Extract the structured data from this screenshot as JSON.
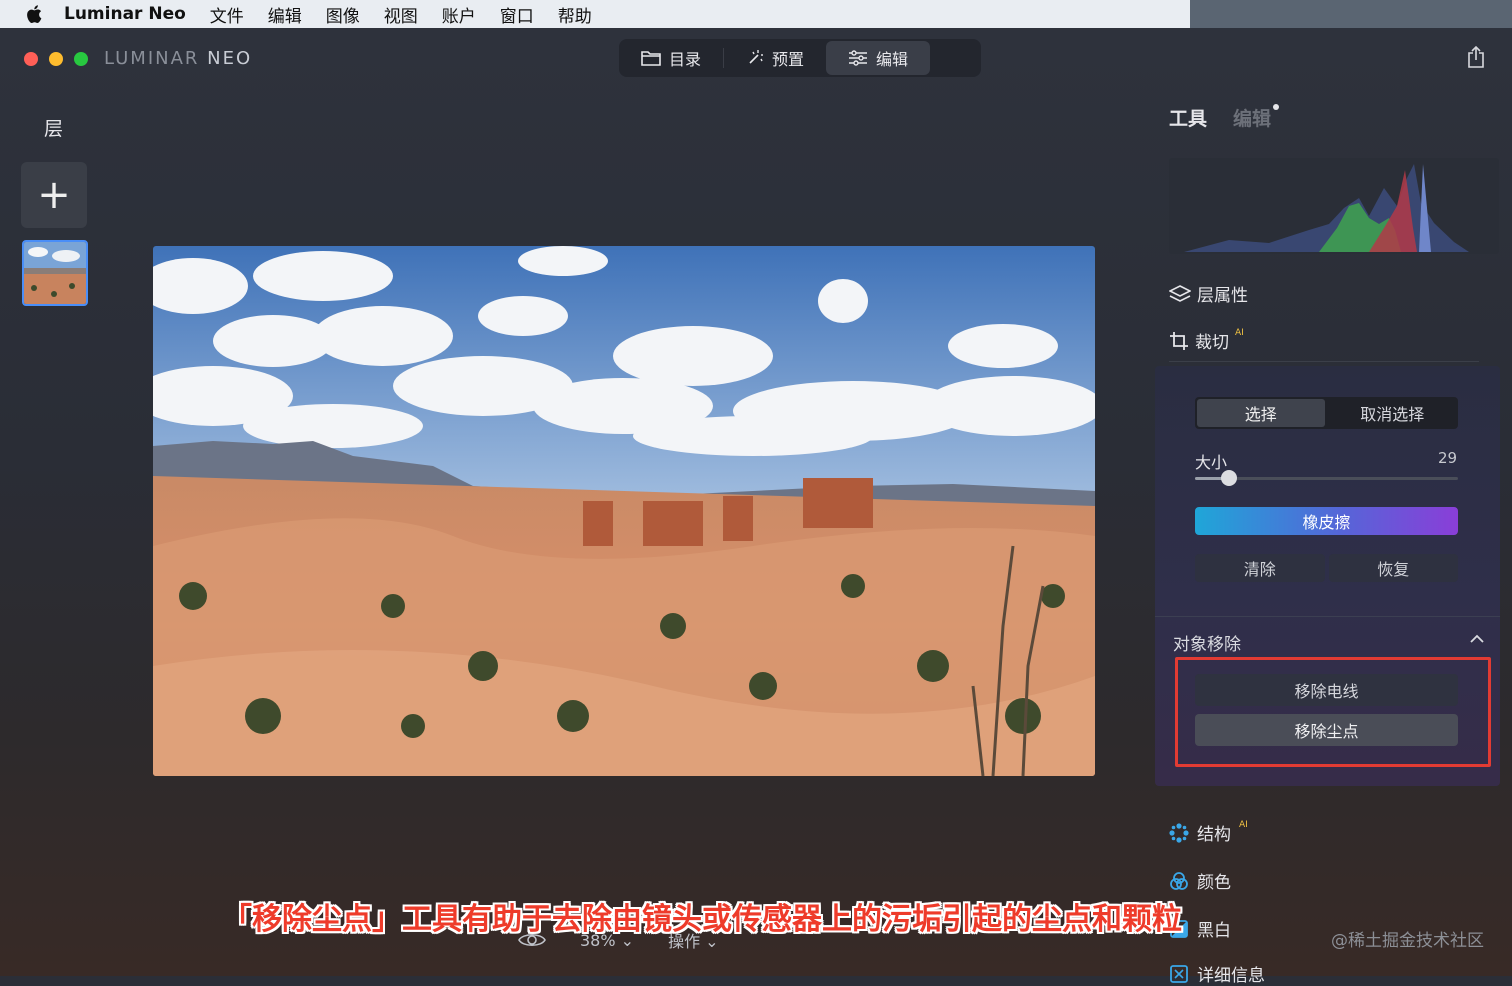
{
  "menubar": {
    "app_name": "Luminar Neo",
    "items": [
      "文件",
      "编辑",
      "图像",
      "视图",
      "账户",
      "窗口",
      "帮助"
    ]
  },
  "header": {
    "logo_a": "LUMINAR",
    "logo_b": "NEO",
    "tabs": [
      {
        "label": "目录",
        "icon": "folder-icon"
      },
      {
        "label": "预置",
        "icon": "magic-wand-icon"
      },
      {
        "label": "编辑",
        "icon": "sliders-icon"
      }
    ],
    "active_tab": "编辑"
  },
  "layers": {
    "title": "层",
    "add_label": "+"
  },
  "right_panel": {
    "tabs": [
      "工具",
      "编辑"
    ],
    "layer_properties": "层属性",
    "crop": "裁切",
    "ai_badge": "AI",
    "toggle": [
      "选择",
      "取消选择"
    ],
    "size_label": "大小",
    "size_value": "29",
    "size_fraction": 0.13,
    "eraser": "橡皮擦",
    "clear": "清除",
    "restore": "恢复",
    "object_removal": "对象移除",
    "remove_wire": "移除电线",
    "remove_dust": "移除尘点",
    "structure": "结构",
    "color": "颜色",
    "bw": "黑白",
    "details": "详细信息"
  },
  "bottom": {
    "zoom": "38%",
    "actions": "操作"
  },
  "caption": "「移除尘点」工具有助于去除由镜头或传感器上的污垢引起的尘点和颗粒",
  "watermark": "@稀土掘金技术社区",
  "colors": {
    "accent": "#4a8ef7",
    "highlight": "#e23b33",
    "ai": "#f1c243"
  }
}
